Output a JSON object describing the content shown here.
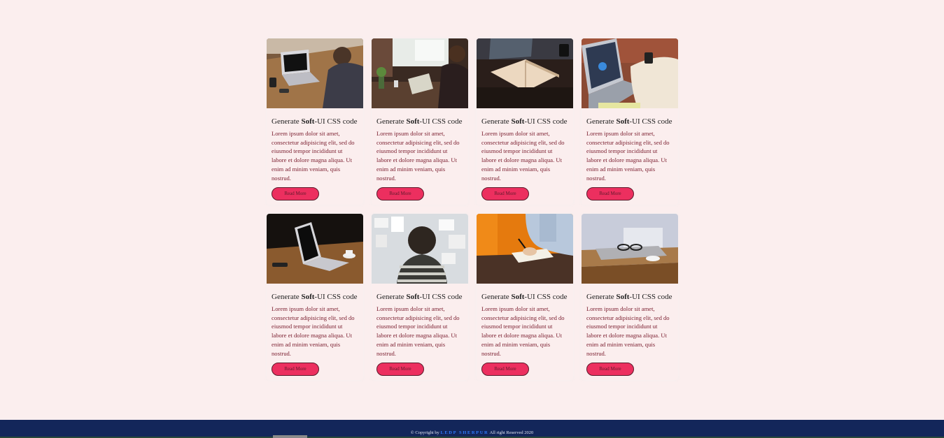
{
  "cards": [
    {
      "title_pre": "Generate ",
      "title_bold": "Soft",
      "title_post": "-UI CSS code",
      "text": "Lorem ipsum dolor sit amet, consectetur adipisicing elit, sed do eiusmod tempor incididunt ut labore et dolore magna aliqua. Ut enim ad minim veniam, quis nostrud.",
      "button": "Read More"
    },
    {
      "title_pre": "Generate ",
      "title_bold": "Soft",
      "title_post": "-UI CSS code",
      "text": "Lorem ipsum dolor sit amet, consectetur adipisicing elit, sed do eiusmod tempor incididunt ut labore et dolore magna aliqua. Ut enim ad minim veniam, quis nostrud.",
      "button": "Read More"
    },
    {
      "title_pre": "Generate ",
      "title_bold": "Soft",
      "title_post": "-UI CSS code",
      "text": "Lorem ipsum dolor sit amet, consectetur adipisicing elit, sed do eiusmod tempor incididunt ut labore et dolore magna aliqua. Ut enim ad minim veniam, quis nostrud.",
      "button": "Read More"
    },
    {
      "title_pre": "Generate ",
      "title_bold": "Soft",
      "title_post": "-UI CSS code",
      "text": "Lorem ipsum dolor sit amet, consectetur adipisicing elit, sed do eiusmod tempor incididunt ut labore et dolore magna aliqua. Ut enim ad minim veniam, quis nostrud.",
      "button": "Read More"
    },
    {
      "title_pre": "Generate ",
      "title_bold": "Soft",
      "title_post": "-UI CSS code",
      "text": "Lorem ipsum dolor sit amet, consectetur adipisicing elit, sed do eiusmod tempor incididunt ut labore et dolore magna aliqua. Ut enim ad minim veniam, quis nostrud.",
      "button": "Read More"
    },
    {
      "title_pre": "Generate ",
      "title_bold": "Soft",
      "title_post": "-UI CSS code",
      "text": "Lorem ipsum dolor sit amet, consectetur adipisicing elit, sed do eiusmod tempor incididunt ut labore et dolore magna aliqua. Ut enim ad minim veniam, quis nostrud.",
      "button": "Read More"
    },
    {
      "title_pre": "Generate ",
      "title_bold": "Soft",
      "title_post": "-UI CSS code",
      "text": "Lorem ipsum dolor sit amet, consectetur adipisicing elit, sed do eiusmod tempor incididunt ut labore et dolore magna aliqua. Ut enim ad minim veniam, quis nostrud.",
      "button": "Read More"
    },
    {
      "title_pre": "Generate ",
      "title_bold": "Soft",
      "title_post": "-UI CSS code",
      "text": "Lorem ipsum dolor sit amet, consectetur adipisicing elit, sed do eiusmod tempor incididunt ut labore et dolore magna aliqua. Ut enim ad minim veniam, quis nostrud.",
      "button": "Read More"
    }
  ],
  "footer": {
    "prefix": "© Copyright by ",
    "brand": "LEDP SHERPUR",
    "suffix": " All right Reserved 2020"
  },
  "colors": {
    "page_bg": "#fbeeee",
    "button_bg": "#ec2f5f",
    "footer_bg": "#13265a",
    "brand": "#2f7bff",
    "body_text": "#7a1d2e"
  }
}
